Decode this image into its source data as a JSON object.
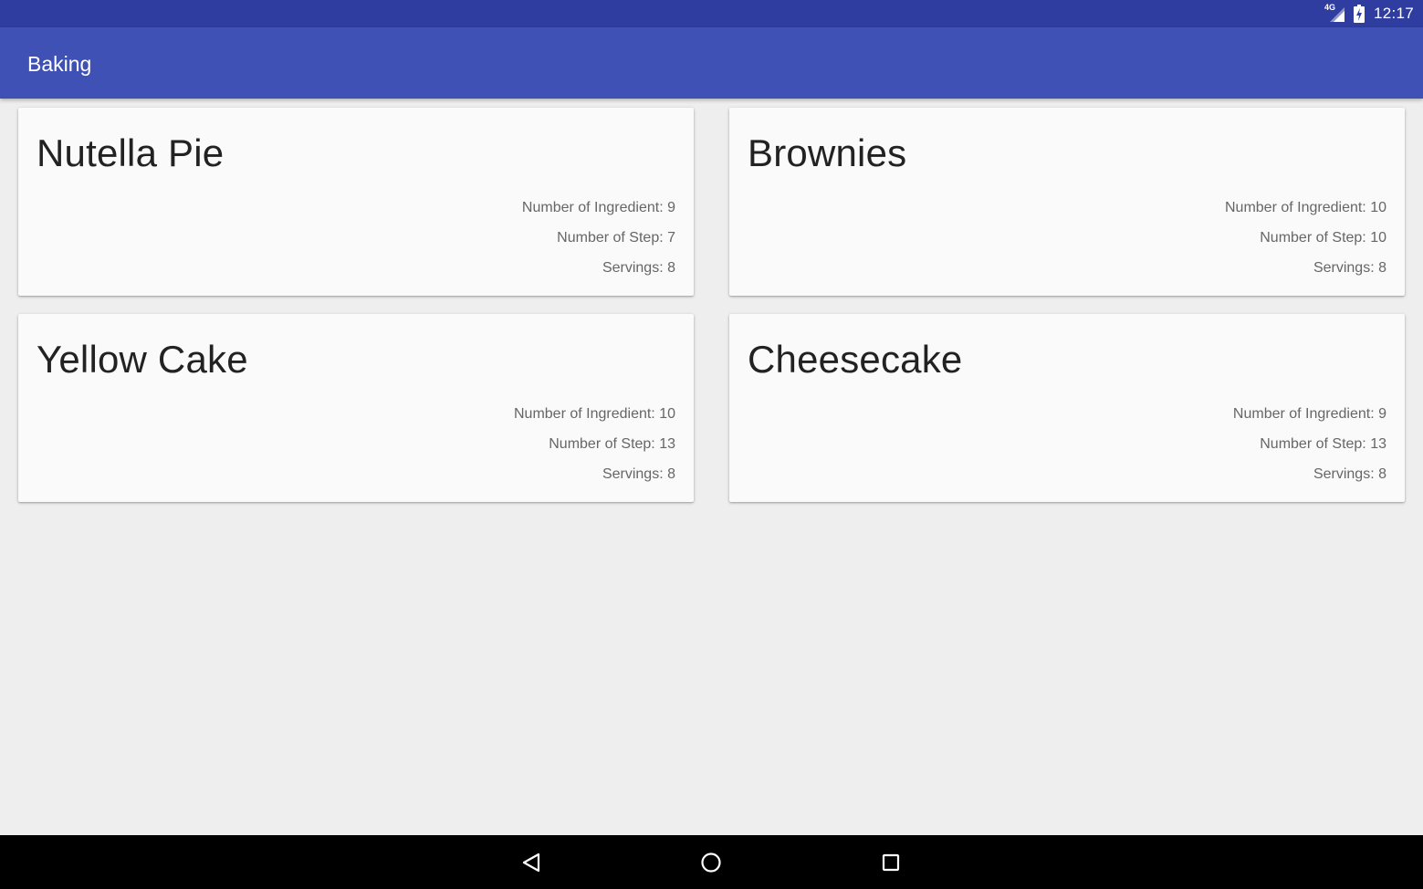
{
  "status_bar": {
    "network_label": "4G",
    "time": "12:17",
    "icons": [
      "signal-icon",
      "battery-charging-icon"
    ]
  },
  "app_bar": {
    "title": "Baking"
  },
  "recipes": [
    {
      "name": "Nutella Pie",
      "ingredients": "Number of Ingredient: 9",
      "steps": "Number of Step: 7",
      "servings": "Servings: 8"
    },
    {
      "name": "Brownies",
      "ingredients": "Number of Ingredient: 10",
      "steps": "Number of Step: 10",
      "servings": "Servings: 8"
    },
    {
      "name": "Yellow Cake",
      "ingredients": "Number of Ingredient: 10",
      "steps": "Number of Step: 13",
      "servings": "Servings: 8"
    },
    {
      "name": "Cheesecake",
      "ingredients": "Number of Ingredient: 9",
      "steps": "Number of Step: 13",
      "servings": "Servings: 8"
    }
  ],
  "nav_bar": {
    "buttons": [
      "back-icon",
      "home-icon",
      "recents-icon"
    ]
  },
  "colors": {
    "status_bar": "#2f3da0",
    "app_bar": "#3f51b5",
    "background": "#eeeeee",
    "card": "#fafafa",
    "nav_bar": "#000000"
  }
}
